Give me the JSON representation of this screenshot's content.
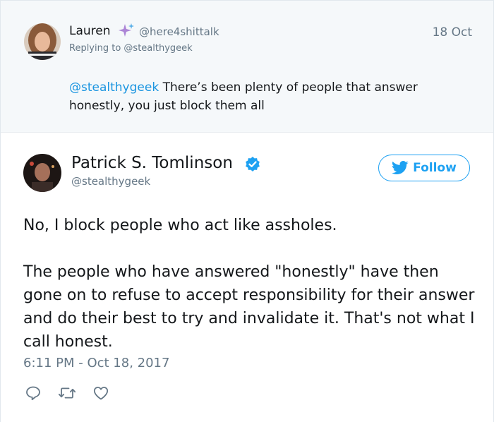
{
  "reply_tweet": {
    "author_name": "Lauren",
    "author_handle": "@here4shittalk",
    "date": "18 Oct",
    "replying_to": "Replying to @stealthygeek",
    "mention": "@stealthygeek",
    "text": " There’s been plenty of people that answer honestly, you just block them all"
  },
  "main_tweet": {
    "author_name": "Patrick S. Tomlinson",
    "author_handle": "@stealthygeek",
    "follow_label": "Follow",
    "paragraph_1": "No, I block people who act like assholes.",
    "paragraph_2": "The people who have answered \"honestly\" have then gone on to refuse to accept responsibility for their answer and do their best to try and invalidate it. That's not what I call honest.",
    "timestamp": "6:11 PM - Oct 18, 2017"
  },
  "colors": {
    "accent": "#1da1f2",
    "link": "#1b95e0",
    "muted": "#657786",
    "reply_background": "#f5f8fa"
  },
  "icons": [
    "sparkles-icon",
    "verified-badge-icon",
    "twitter-bird-icon",
    "reply-icon",
    "retweet-icon",
    "like-icon"
  ]
}
